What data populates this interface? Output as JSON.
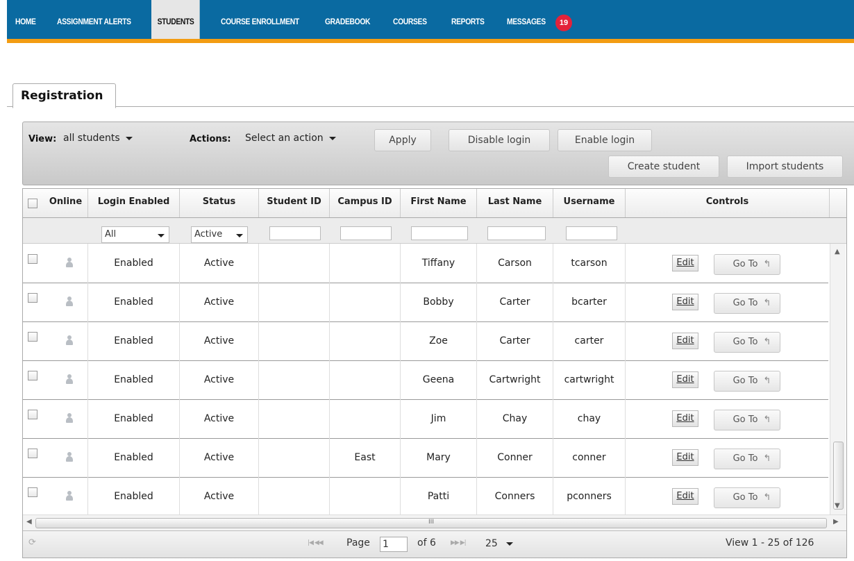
{
  "nav": {
    "items": [
      {
        "label": "HOME"
      },
      {
        "label": "ASSIGNMENT ALERTS"
      },
      {
        "label": "STUDENTS"
      },
      {
        "label": "COURSE ENROLLMENT"
      },
      {
        "label": "GRADEBOOK"
      },
      {
        "label": "COURSES"
      },
      {
        "label": "REPORTS"
      },
      {
        "label": "MESSAGES"
      }
    ],
    "active": "STUDENTS",
    "messages_badge": "19",
    "colors": {
      "bar": "#0a6aa1",
      "stripe": "#f39c12",
      "badge": "#e3223a"
    }
  },
  "tab": {
    "label": "Registration"
  },
  "toolbar": {
    "view_label": "View:",
    "view_value": "all students",
    "actions_label": "Actions:",
    "actions_value": "Select an action",
    "apply": "Apply",
    "disable_login": "Disable login",
    "enable_login": "Enable login",
    "create_student": "Create student",
    "import_students": "Import students"
  },
  "grid": {
    "columns": [
      "Online",
      "Login Enabled",
      "Status",
      "Student ID",
      "Campus ID",
      "First Name",
      "Last Name",
      "Username",
      "Controls"
    ],
    "filters": {
      "login_enabled": "All",
      "status": "Active"
    },
    "rows": [
      {
        "login": "Enabled",
        "status": "Active",
        "student_id": "",
        "campus_id": "",
        "first": "Tiffany",
        "last": "Carson",
        "username": "tcarson"
      },
      {
        "login": "Enabled",
        "status": "Active",
        "student_id": "",
        "campus_id": "",
        "first": "Bobby",
        "last": "Carter",
        "username": "bcarter"
      },
      {
        "login": "Enabled",
        "status": "Active",
        "student_id": "",
        "campus_id": "",
        "first": "Zoe",
        "last": "Carter",
        "username": "carter"
      },
      {
        "login": "Enabled",
        "status": "Active",
        "student_id": "",
        "campus_id": "",
        "first": "Geena",
        "last": "Cartwright",
        "username": "cartwright"
      },
      {
        "login": "Enabled",
        "status": "Active",
        "student_id": "",
        "campus_id": "",
        "first": "Jim",
        "last": "Chay",
        "username": "chay"
      },
      {
        "login": "Enabled",
        "status": "Active",
        "student_id": "",
        "campus_id": "East",
        "first": "Mary",
        "last": "Conner",
        "username": "conner"
      },
      {
        "login": "Enabled",
        "status": "Active",
        "student_id": "",
        "campus_id": "",
        "first": "Patti",
        "last": "Conners",
        "username": "pconners"
      }
    ],
    "edit_label": "Edit",
    "goto_label": "Go To"
  },
  "pager": {
    "page_label": "Page",
    "page_value": "1",
    "of_label": "of 6",
    "per_page": "25",
    "summary": "View 1 - 25 of 126"
  }
}
